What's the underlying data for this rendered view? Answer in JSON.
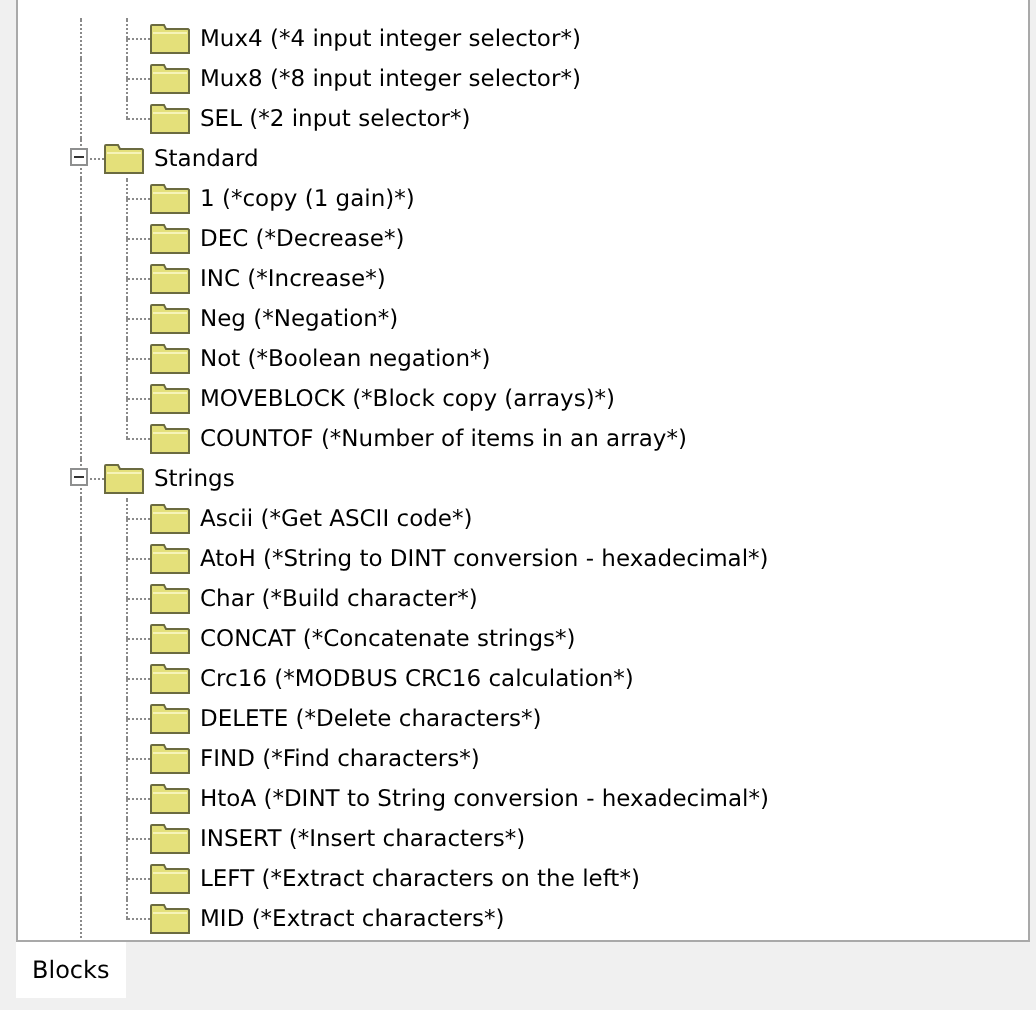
{
  "tree": {
    "continued_items": [
      {
        "label": "Mux4 (*4 input integer selector*)"
      },
      {
        "label": "Mux8 (*8 input integer selector*)"
      },
      {
        "label": "SEL (*2 input selector*)"
      }
    ],
    "groups": [
      {
        "label": "Standard",
        "expanded": true,
        "children": [
          {
            "label": "1 (*copy (1 gain)*)"
          },
          {
            "label": "DEC (*Decrease*)"
          },
          {
            "label": "INC (*Increase*)"
          },
          {
            "label": "Neg (*Negation*)"
          },
          {
            "label": "Not (*Boolean negation*)"
          },
          {
            "label": "MOVEBLOCK (*Block copy (arrays)*)"
          },
          {
            "label": "COUNTOF (*Number of items in an array*)"
          }
        ]
      },
      {
        "label": "Strings",
        "expanded": true,
        "children": [
          {
            "label": "Ascii (*Get ASCII code*)"
          },
          {
            "label": "AtoH (*String to DINT conversion - hexadecimal*)"
          },
          {
            "label": "Char (*Build character*)"
          },
          {
            "label": "CONCAT (*Concatenate strings*)"
          },
          {
            "label": "Crc16 (*MODBUS CRC16 calculation*)"
          },
          {
            "label": "DELETE (*Delete characters*)"
          },
          {
            "label": "FIND (*Find characters*)"
          },
          {
            "label": "HtoA (*DINT to String conversion - hexadecimal*)"
          },
          {
            "label": "INSERT (*Insert characters*)"
          },
          {
            "label": "LEFT (*Extract characters on the left*)"
          },
          {
            "label": "MID (*Extract characters*)"
          }
        ]
      }
    ]
  },
  "tabs": [
    {
      "label": "Blocks",
      "selected": true
    }
  ]
}
